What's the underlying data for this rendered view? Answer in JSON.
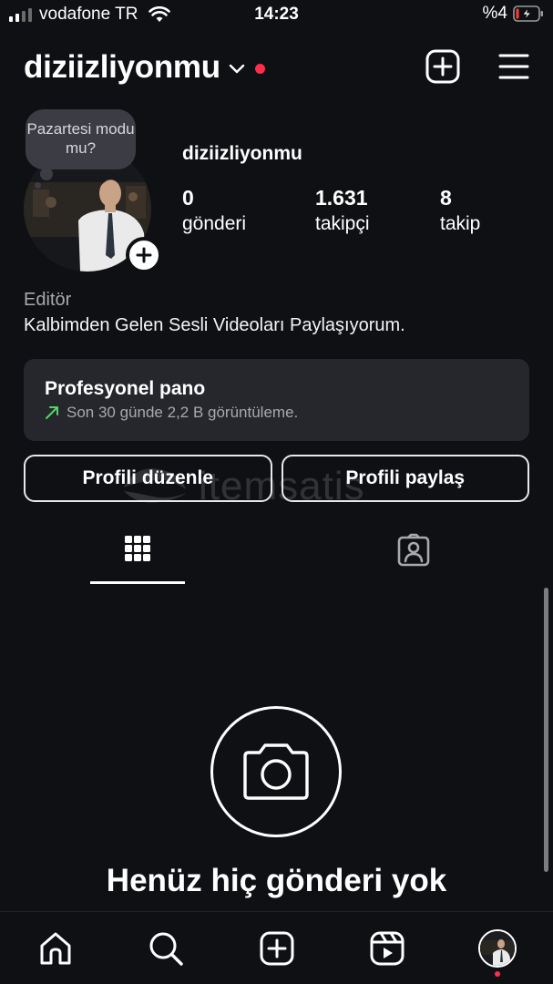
{
  "status_bar": {
    "carrier": "vodafone TR",
    "time": "14:23",
    "battery": "%4"
  },
  "header": {
    "username": "diziizliyonmu"
  },
  "profile": {
    "note": "Pazartesi modu mu?",
    "name": "diziizliyonmu",
    "stats": [
      {
        "value": "0",
        "label": "gönderi"
      },
      {
        "value": "1.631",
        "label": "takipçi"
      },
      {
        "value": "8",
        "label": "takip"
      }
    ],
    "category": "Editör",
    "bio": "Kalbimden Gelen Sesli Videoları Paylaşıyorum."
  },
  "dashboard": {
    "title": "Profesyonel pano",
    "subtitle": "Son 30 günde 2,2 B görüntüleme."
  },
  "actions": {
    "edit_profile": "Profili düzenle",
    "share_profile": "Profili paylaş"
  },
  "watermark": {
    "text": "itemsatis"
  },
  "empty_state": {
    "title": "Henüz hiç gönderi yok"
  },
  "icons": {
    "signal": "cellular-signal-icon",
    "wifi": "wifi-icon",
    "battery": "battery-charging-icon",
    "chevron": "chevron-down-icon",
    "create": "plus-square-icon",
    "menu": "hamburger-menu-icon",
    "add": "plus-icon",
    "trend": "trend-up-arrow-icon",
    "grid": "grid-icon",
    "tagged": "tagged-user-icon",
    "camera": "camera-icon",
    "home": "home-icon",
    "search": "search-icon",
    "reels": "reels-icon"
  },
  "colors": {
    "background": "#0f1014",
    "card": "#26272d",
    "accent_red": "#ff2f4b",
    "trend_green": "#4cd964",
    "secondary_text": "#a8a8ad"
  }
}
